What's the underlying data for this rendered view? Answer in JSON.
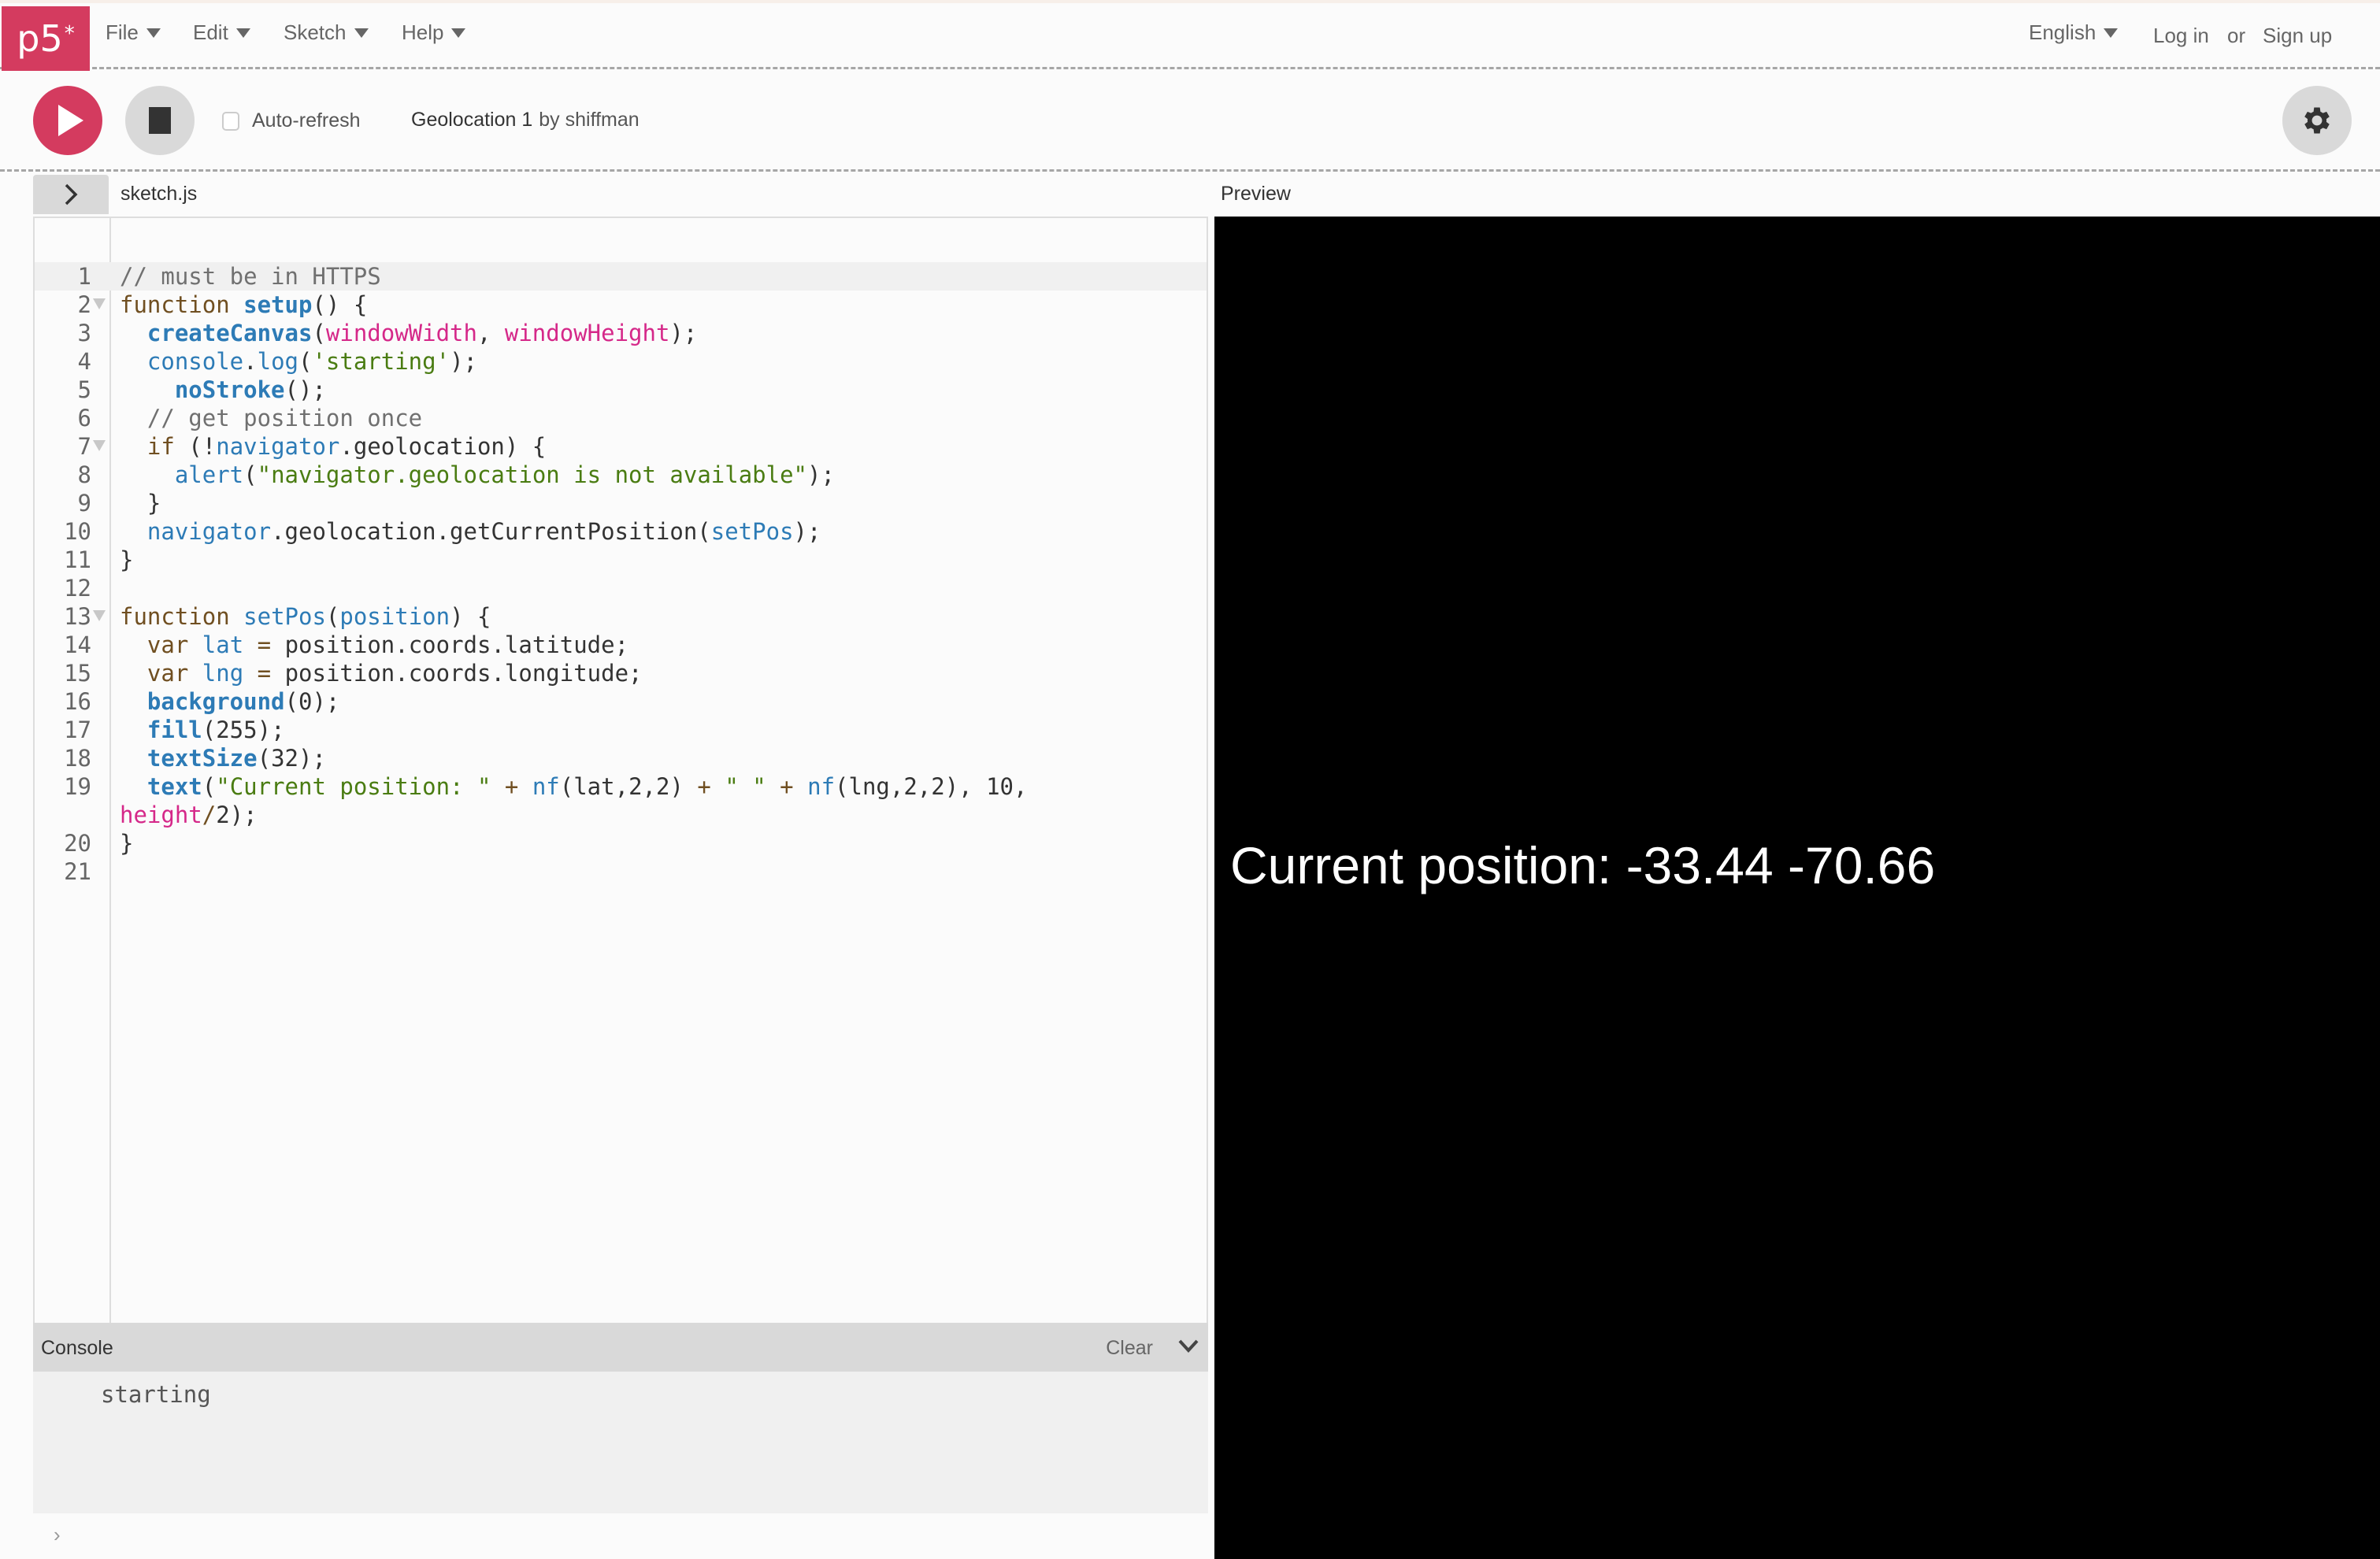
{
  "app": {
    "logo_text": "p5",
    "logo_sup": "*",
    "brand_color": "#d43b5f"
  },
  "nav": {
    "menus": [
      {
        "label": "File"
      },
      {
        "label": "Edit"
      },
      {
        "label": "Sketch"
      },
      {
        "label": "Help"
      }
    ],
    "language": "English",
    "login": "Log in",
    "or": "or",
    "signup": "Sign up"
  },
  "toolbar": {
    "play_icon": "play-icon",
    "stop_icon": "stop-icon",
    "auto_refresh_label": "Auto-refresh",
    "auto_refresh_checked": false,
    "project_name": "Geolocation 1",
    "by": "by shiffman",
    "settings_icon": "gear-icon"
  },
  "editor": {
    "file_name": "sketch.js",
    "active_line": 1,
    "lines": [
      {
        "n": "1",
        "fold": false,
        "tokens": [
          [
            "c-comment",
            "// must be in HTTPS"
          ]
        ]
      },
      {
        "n": "2",
        "fold": true,
        "tokens": [
          [
            "c-kw",
            "function"
          ],
          [
            "",
            " "
          ],
          [
            "c-fnb",
            "setup"
          ],
          [
            "",
            "() {"
          ]
        ]
      },
      {
        "n": "3",
        "fold": false,
        "tokens": [
          [
            "",
            "  "
          ],
          [
            "c-fnb",
            "createCanvas"
          ],
          [
            "",
            "("
          ],
          [
            "c-var",
            "windowWidth"
          ],
          [
            "",
            ", "
          ],
          [
            "c-var",
            "windowHeight"
          ],
          [
            "",
            ");"
          ]
        ]
      },
      {
        "n": "4",
        "fold": false,
        "tokens": [
          [
            "",
            "  "
          ],
          [
            "c-fn",
            "console"
          ],
          [
            "",
            "."
          ],
          [
            "c-fn",
            "log"
          ],
          [
            "",
            "("
          ],
          [
            "c-str",
            "'starting'"
          ],
          [
            "",
            ");"
          ]
        ]
      },
      {
        "n": "5",
        "fold": false,
        "tokens": [
          [
            "",
            "    "
          ],
          [
            "c-fnb",
            "noStroke"
          ],
          [
            "",
            "();"
          ]
        ]
      },
      {
        "n": "6",
        "fold": false,
        "tokens": [
          [
            "",
            "  "
          ],
          [
            "c-comment",
            "// get position once"
          ]
        ]
      },
      {
        "n": "7",
        "fold": true,
        "tokens": [
          [
            "",
            "  "
          ],
          [
            "c-kw",
            "if"
          ],
          [
            "",
            " (!"
          ],
          [
            "c-fn",
            "navigator"
          ],
          [
            "",
            ".geolocation) {"
          ]
        ]
      },
      {
        "n": "8",
        "fold": false,
        "tokens": [
          [
            "",
            "    "
          ],
          [
            "c-fn",
            "alert"
          ],
          [
            "",
            "("
          ],
          [
            "c-str",
            "\"navigator.geolocation is not available\""
          ],
          [
            "",
            ");"
          ]
        ]
      },
      {
        "n": "9",
        "fold": false,
        "tokens": [
          [
            "",
            "  }"
          ]
        ]
      },
      {
        "n": "10",
        "fold": false,
        "tokens": [
          [
            "",
            "  "
          ],
          [
            "c-fn",
            "navigator"
          ],
          [
            "",
            ".geolocation.getCurrentPosition("
          ],
          [
            "c-fn",
            "setPos"
          ],
          [
            "",
            ");"
          ]
        ]
      },
      {
        "n": "11",
        "fold": false,
        "tokens": [
          [
            "",
            "}"
          ]
        ]
      },
      {
        "n": "12",
        "fold": false,
        "tokens": []
      },
      {
        "n": "13",
        "fold": true,
        "tokens": [
          [
            "c-kw",
            "function"
          ],
          [
            "",
            " "
          ],
          [
            "c-fn",
            "setPos"
          ],
          [
            "",
            "("
          ],
          [
            "c-fn",
            "position"
          ],
          [
            "",
            ") {"
          ]
        ]
      },
      {
        "n": "14",
        "fold": false,
        "tokens": [
          [
            "",
            "  "
          ],
          [
            "c-kw",
            "var"
          ],
          [
            "",
            " "
          ],
          [
            "c-fn",
            "lat"
          ],
          [
            "",
            " "
          ],
          [
            "c-op",
            "="
          ],
          [
            "",
            " position.coords.latitude;"
          ]
        ]
      },
      {
        "n": "15",
        "fold": false,
        "tokens": [
          [
            "",
            "  "
          ],
          [
            "c-kw",
            "var"
          ],
          [
            "",
            " "
          ],
          [
            "c-fn",
            "lng"
          ],
          [
            "",
            " "
          ],
          [
            "c-op",
            "="
          ],
          [
            "",
            " position.coords.longitude;"
          ]
        ]
      },
      {
        "n": "16",
        "fold": false,
        "tokens": [
          [
            "",
            "  "
          ],
          [
            "c-fnb",
            "background"
          ],
          [
            "",
            "(0);"
          ]
        ]
      },
      {
        "n": "17",
        "fold": false,
        "tokens": [
          [
            "",
            "  "
          ],
          [
            "c-fnb",
            "fill"
          ],
          [
            "",
            "(255);"
          ]
        ]
      },
      {
        "n": "18",
        "fold": false,
        "tokens": [
          [
            "",
            "  "
          ],
          [
            "c-fnb",
            "textSize"
          ],
          [
            "",
            "(32);"
          ]
        ]
      },
      {
        "n": "19",
        "fold": false,
        "tokens": [
          [
            "",
            "  "
          ],
          [
            "c-fnb",
            "text"
          ],
          [
            "",
            "("
          ],
          [
            "c-str",
            "\"Current position: \""
          ],
          [
            "",
            " "
          ],
          [
            "c-op",
            "+"
          ],
          [
            "",
            " "
          ],
          [
            "c-fn",
            "nf"
          ],
          [
            "",
            "(lat,2,2) "
          ],
          [
            "c-op",
            "+"
          ],
          [
            "",
            " "
          ],
          [
            "c-str",
            "\" \""
          ],
          [
            "",
            " "
          ],
          [
            "c-op",
            "+"
          ],
          [
            "",
            " "
          ],
          [
            "c-fn",
            "nf"
          ],
          [
            "",
            "(lng,2,2), 10,"
          ]
        ]
      },
      {
        "n": "",
        "fold": false,
        "tokens": [
          [
            "c-var",
            "height"
          ],
          [
            "c-op",
            "/"
          ],
          [
            "",
            "2);"
          ]
        ]
      },
      {
        "n": "20",
        "fold": false,
        "tokens": [
          [
            "",
            "}"
          ]
        ]
      },
      {
        "n": "21",
        "fold": false,
        "tokens": []
      }
    ]
  },
  "console": {
    "title": "Console",
    "clear_label": "Clear",
    "messages": [
      "starting"
    ],
    "prompt": "›"
  },
  "preview": {
    "label": "Preview",
    "canvas_text": "Current position: -33.44 -70.66",
    "background": "#000000",
    "text_color": "#ffffff"
  }
}
